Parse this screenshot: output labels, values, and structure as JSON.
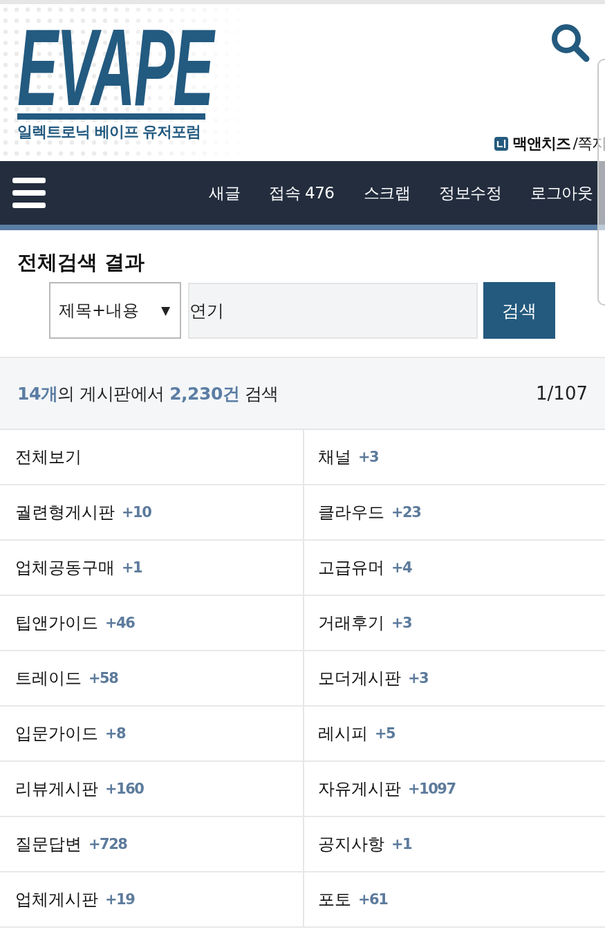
{
  "header": {
    "logo": {
      "wordmark": "EVAPE",
      "tagline": "일렉트로닉 베이프 유저포럼"
    },
    "user": {
      "name": "맥앤치즈",
      "messages_link": "/쪽지"
    }
  },
  "nav": {
    "items": [
      "새글",
      "접속 476",
      "스크랩",
      "정보수정",
      "로그아웃"
    ]
  },
  "search": {
    "title": "전체검색 결과",
    "scope": "제목+내용",
    "scope_caret": "▼",
    "query": "연기",
    "button": "검색"
  },
  "summary": {
    "text": "**14개**의 게시판에서 **2,230건** 검색",
    "page": "1/107"
  },
  "boards": [
    {
      "name": "전체보기"
    },
    {
      "name": "채널",
      "count": "+3"
    },
    {
      "name": "궐련형게시판",
      "count": "+10"
    },
    {
      "name": "클라우드",
      "count": "+23"
    },
    {
      "name": "업체공동구매",
      "count": "+1"
    },
    {
      "name": "고급유머",
      "count": "+4"
    },
    {
      "name": "팁앤가이드",
      "count": "+46"
    },
    {
      "name": "거래후기",
      "count": "+3"
    },
    {
      "name": "트레이드",
      "count": "+58"
    },
    {
      "name": "모더게시판",
      "count": "+3"
    },
    {
      "name": "입문가이드",
      "count": "+8"
    },
    {
      "name": "레시피",
      "count": "+5"
    },
    {
      "name": "리뷰게시판",
      "count": "+160"
    },
    {
      "name": "자유게시판",
      "count": "+1097"
    },
    {
      "name": "질문답변",
      "count": "+728"
    },
    {
      "name": "공지사항",
      "count": "+1"
    },
    {
      "name": "업체게시판",
      "count": "+19"
    },
    {
      "name": "포토",
      "count": "+61"
    }
  ]
}
